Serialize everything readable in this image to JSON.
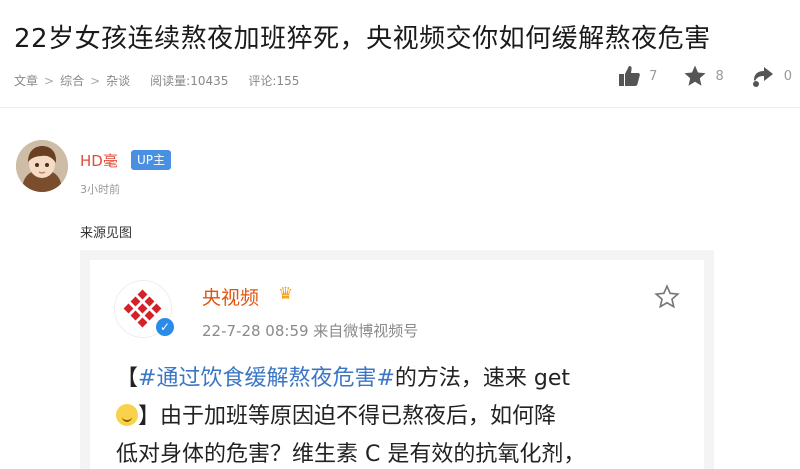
{
  "article": {
    "title": "22岁女孩连续熬夜加班猝死，央视频交你如何缓解熬夜危害",
    "breadcrumb": [
      "文章",
      "综合",
      "杂谈"
    ],
    "breadcrumb_sep": ">",
    "views": "阅读量:10435",
    "comments": "评论:155",
    "likes": "7",
    "favorites": "8",
    "shares": "0"
  },
  "post": {
    "author": "HD毫",
    "badge": "UP主",
    "time": "3小时前",
    "text": "来源见图"
  },
  "embed": {
    "name": "央视频",
    "meta": "22-7-28 08:59 来自微博视频号",
    "line1_bracket": "【",
    "line1_topic": "#通过饮食缓解熬夜危害#",
    "line1_rest": "的方法，速来 get",
    "line2": "】由于加班等原因迫不得已熬夜后，如何降",
    "line3": "低对身体的危害？维生素 C 是有效的抗氧化剂，"
  },
  "icons": {
    "like": "thumbs-up-icon",
    "favorite": "star-icon",
    "share": "share-icon",
    "verify": "verified-icon"
  },
  "colors": {
    "author": "#e04b3a",
    "badge": "#4a90e2",
    "topic": "#3a76c4",
    "brand": "#e3540e"
  }
}
